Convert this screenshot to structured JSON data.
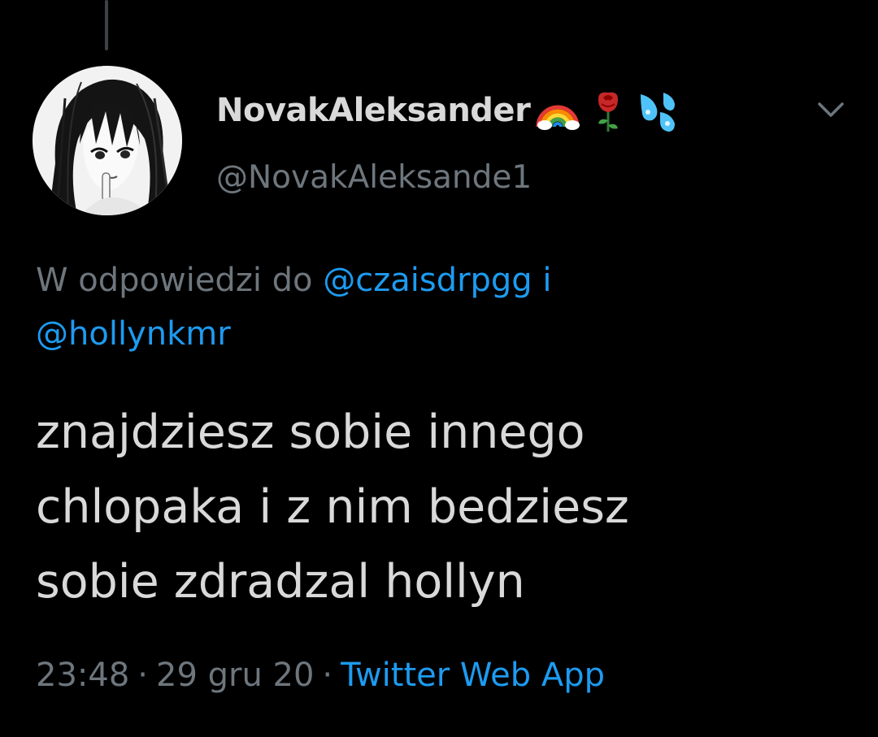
{
  "tweet": {
    "author": {
      "display_name": "NovakAleksander",
      "name_emojis": [
        "rainbow-emoji",
        "rose-emoji",
        "sweat-droplets-emoji"
      ],
      "handle": "@NovakAleksande1",
      "avatar": "manga-girl-avatar"
    },
    "reply_context": {
      "prefix": "W odpowiedzi do",
      "mention_1": "@czaisdrpgg",
      "conjunction": "i",
      "mention_2": "@hollynkmr"
    },
    "text": "znajdziesz sobie innego\nchlopaka i z nim bedziesz\nsobie zdradzal hollyn",
    "time": "23:48",
    "date": "29 gru 20",
    "separator": "·",
    "source": "Twitter Web App",
    "menu_icon": "chevron-down-icon"
  },
  "colors": {
    "background": "#000000",
    "primary_text": "#d9d9d9",
    "secondary_text": "#6e767d",
    "link": "#1d9bf0",
    "thread_line": "#3d4248"
  }
}
